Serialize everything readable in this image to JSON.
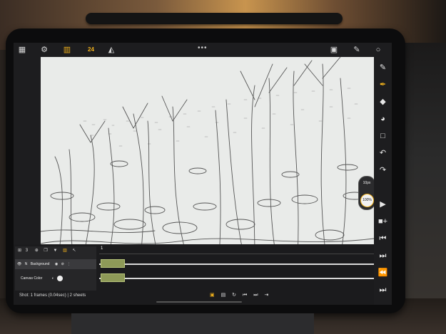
{
  "app": {
    "toolbar": {
      "frame_counter": "24",
      "icons": [
        "grid-icon",
        "settings-gear-icon",
        "film-strip-icon",
        "onion-skin-icon",
        "more-dots-icon",
        "canvas-icon",
        "pencil-icon",
        "color-circle-icon"
      ]
    },
    "right_tools": [
      "pencil-icon",
      "pen-icon",
      "eraser-icon",
      "fill-icon",
      "selection-icon",
      "undo-icon",
      "redo-icon",
      "play-icon",
      "add-frame-icon",
      "first-frame-icon",
      "prev-frame-icon",
      "next-frame-icon",
      "last-frame-icon"
    ],
    "brush": {
      "size_label": "10px",
      "opacity_label": "100%"
    },
    "layers": {
      "toolbar_label": "3",
      "rows": [
        {
          "name": "N",
          "label": "Background",
          "blend": "normal"
        },
        {
          "name": "Canvas Color",
          "label": "Canvas Color",
          "blend": ""
        }
      ]
    },
    "timeline": {
      "current_frame": "1",
      "shot_info": "Shot: 1 frames (0.04sec) | 2 sheets"
    }
  }
}
